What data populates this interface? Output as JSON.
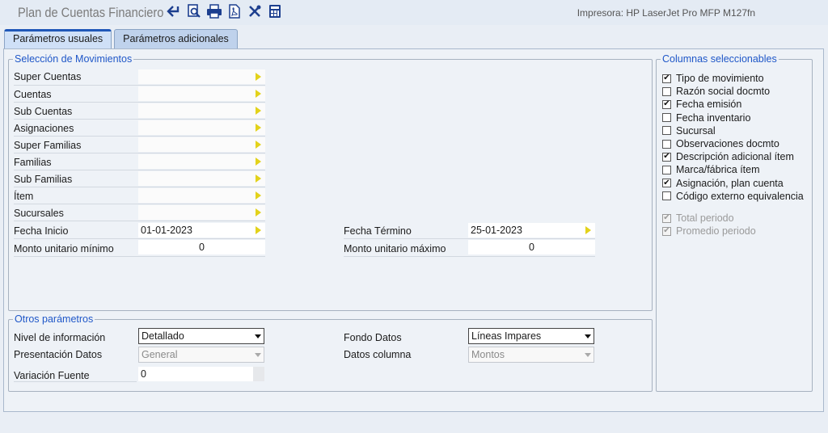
{
  "app": {
    "title": "Plan de Cuentas Financiero",
    "printer": "Impresora: HP LaserJet Pro MFP M127fn"
  },
  "toolbar": {
    "icons": [
      "back-arrow-icon",
      "preview-icon",
      "print-icon",
      "pdf-icon",
      "tools-icon",
      "calculator-icon"
    ]
  },
  "tabs": [
    {
      "label": "Parámetros usuales",
      "active": true
    },
    {
      "label": "Parámetros adicionales",
      "active": false
    }
  ],
  "movimientos": {
    "legend": "Selección de Movimientos",
    "fields": [
      {
        "label": "Super Cuentas",
        "value": ""
      },
      {
        "label": "Cuentas",
        "value": ""
      },
      {
        "label": "Sub Cuentas",
        "value": ""
      },
      {
        "label": "Asignaciones",
        "value": ""
      },
      {
        "label": "Super Familias",
        "value": ""
      },
      {
        "label": "Familias",
        "value": ""
      },
      {
        "label": "Sub Familias",
        "value": ""
      },
      {
        "label": "Ítem",
        "value": ""
      },
      {
        "label": "Sucursales",
        "value": ""
      }
    ],
    "fecha_inicio": {
      "label": "Fecha Inicio",
      "value": "01-01-2023"
    },
    "fecha_termino": {
      "label": "Fecha Término",
      "value": "25-01-2023"
    },
    "monto_min": {
      "label": "Monto unitario mínimo",
      "value": "0"
    },
    "monto_max": {
      "label": "Monto unitario máximo",
      "value": "0"
    }
  },
  "otros": {
    "legend": "Otros parámetros",
    "nivel": {
      "label": "Nivel de información",
      "value": "Detallado"
    },
    "presentacion": {
      "label": "Presentación Datos",
      "value": "General"
    },
    "variacion": {
      "label": "Variación Fuente",
      "value": "0"
    },
    "fondo": {
      "label": "Fondo Datos",
      "value": "Líneas Impares"
    },
    "datos_columna": {
      "label": "Datos columna",
      "value": "Montos"
    }
  },
  "columnas": {
    "legend": "Columnas seleccionables",
    "items": [
      {
        "label": "Tipo de movimiento",
        "checked": true
      },
      {
        "label": "Razón social docmto",
        "checked": false
      },
      {
        "label": "Fecha emisión",
        "checked": true
      },
      {
        "label": "Fecha inventario",
        "checked": false
      },
      {
        "label": "Sucursal",
        "checked": false
      },
      {
        "label": "Observaciones docmto",
        "checked": false
      },
      {
        "label": "Descripción adicional ítem",
        "checked": true
      },
      {
        "label": "Marca/fábrica ítem",
        "checked": false
      },
      {
        "label": "Asignación, plan cuenta",
        "checked": true
      },
      {
        "label": "Código externo equivalencia",
        "checked": false
      }
    ],
    "disabled_items": [
      {
        "label": "Total periodo",
        "checked": true
      },
      {
        "label": "Promedio periodo",
        "checked": true
      }
    ]
  },
  "colors": {
    "accent": "#1f57c8",
    "arrow": "#e3d21a"
  }
}
